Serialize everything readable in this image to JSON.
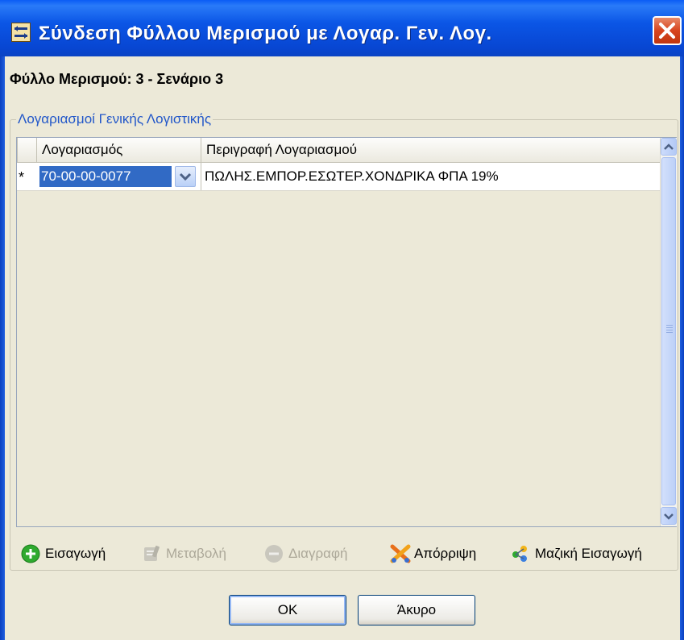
{
  "window": {
    "title": "Σύνδεση Φύλλου Μερισμού με Λογαρ. Γεν. Λογ."
  },
  "caption": "Φύλλο Μερισμού: 3 - Σενάριο 3",
  "group": {
    "title": "Λογαριασμοί Γενικής Λογιστικής"
  },
  "grid": {
    "columns": [
      "Λογαριασμός",
      "Περιγραφή Λογαριασμού"
    ],
    "rows": [
      {
        "indicator": "*",
        "account": "70-00-00-0077",
        "description": "ΠΩΛΗΣ.ΕΜΠΟΡ.ΕΣΩΤΕΡ.ΧΟΝΔΡΙΚΑ ΦΠΑ 19%"
      }
    ]
  },
  "toolbar": {
    "insert_label": "Εισαγωγή",
    "modify_label": "Μεταβολή",
    "delete_label": "Διαγραφή",
    "reject_label": "Απόρριψη",
    "bulk_insert_label": "Μαζική Εισαγωγή"
  },
  "buttons": {
    "ok_label": "OK",
    "cancel_label": "Άκυρο"
  },
  "colors": {
    "title_bar": "#0a56e6",
    "client_bg": "#ece9d8",
    "selection": "#316ac5",
    "group_title": "#2257c9",
    "close_button": "#d8441e"
  },
  "icons": {
    "title": "window-link-icon",
    "insert": "plus-circle-icon",
    "modify": "edit-icon",
    "delete": "minus-circle-icon",
    "reject": "scissors-x-icon",
    "bulk_insert": "multi-insert-icon"
  }
}
